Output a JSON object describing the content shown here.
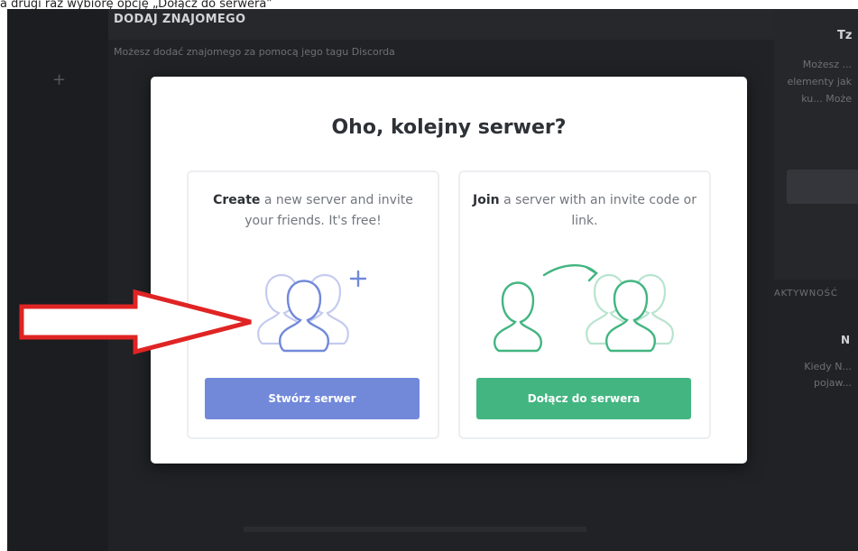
{
  "caption": {
    "text": "a drugi raz wybiorę opcję „Dołącz do serwera”"
  },
  "background": {
    "heading": "DODAJ ZNAJOMEGO",
    "subtext": "Możesz dodać znajomego za pomocą jego tagu Discorda",
    "right_title": "Tz",
    "right_text": "Możesz ... elementy jak ku... Może",
    "right_subheading": "AKTYWNOŚĆ",
    "right_n": "N",
    "right_text2": "Kiedy N... pojaw..."
  },
  "modal": {
    "title": "Oho, kolejny serwer?",
    "create": {
      "lead": "Create",
      "desc": " a new server and invite your friends. It's free!",
      "button": "Stwórz serwer",
      "icon": "group-add-icon"
    },
    "join": {
      "lead": "Join",
      "desc": " a server with an invite code or link.",
      "button": "Dołącz do serwera",
      "icon": "join-server-icon"
    }
  },
  "colors": {
    "create_button": "#7289da",
    "join_button": "#43b581",
    "annotation_arrow": "#e02424"
  }
}
